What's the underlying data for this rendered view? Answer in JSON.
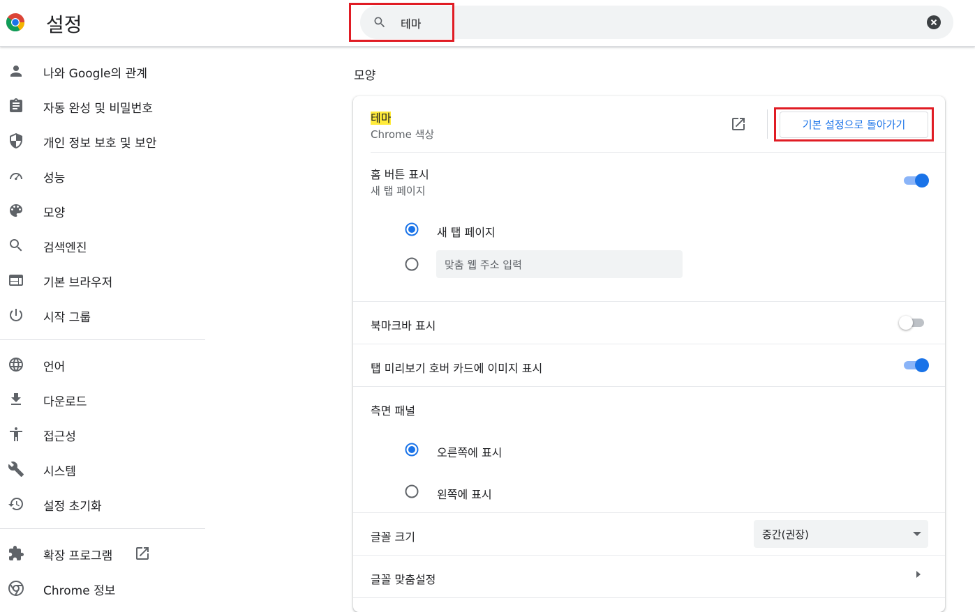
{
  "header": {
    "title": "설정",
    "search_value": "테마"
  },
  "sidebar": {
    "items": [
      {
        "label": "나와 Google의 관계",
        "icon": "person-icon"
      },
      {
        "label": "자동 완성 및 비밀번호",
        "icon": "clipboard-icon"
      },
      {
        "label": "개인 정보 보호 및 보안",
        "icon": "shield-icon"
      },
      {
        "label": "성능",
        "icon": "speedometer-icon"
      },
      {
        "label": "모양",
        "icon": "palette-icon"
      },
      {
        "label": "검색엔진",
        "icon": "search-icon"
      },
      {
        "label": "기본 브라우저",
        "icon": "browser-icon"
      },
      {
        "label": "시작 그룹",
        "icon": "power-icon"
      },
      {
        "label": "언어",
        "icon": "globe-icon"
      },
      {
        "label": "다운로드",
        "icon": "download-icon"
      },
      {
        "label": "접근성",
        "icon": "accessibility-icon"
      },
      {
        "label": "시스템",
        "icon": "wrench-icon"
      },
      {
        "label": "설정 초기화",
        "icon": "history-icon"
      },
      {
        "label": "확장 프로그램",
        "icon": "puzzle-icon"
      },
      {
        "label": "Chrome 정보",
        "icon": "chrome-icon"
      }
    ]
  },
  "main": {
    "section_title": "모양",
    "theme": {
      "title": "테마",
      "subtitle": "Chrome 색상",
      "reset_label": "기본 설정으로 돌아가기"
    },
    "home_button": {
      "title": "홈 버튼 표시",
      "subtitle": "새 탭 페이지",
      "enabled": true,
      "options": [
        "새 탭 페이지",
        ""
      ],
      "selected": 0,
      "url_placeholder": "맞춤 웹 주소 입력"
    },
    "bookmarks_bar": {
      "title": "북마크바 표시",
      "enabled": false
    },
    "tab_hover": {
      "title": "탭 미리보기 호버 카드에 이미지 표시",
      "enabled": true
    },
    "side_panel": {
      "title": "측면 패널",
      "options": [
        "오른쪽에 표시",
        "왼쪽에 표시"
      ],
      "selected": 0
    },
    "font_size": {
      "title": "글꼴 크기",
      "value": "중간(권장)"
    },
    "customize_fonts": {
      "title": "글꼴 맞춤설정"
    }
  },
  "colors": {
    "accent": "#1a73e8",
    "highlight_box": "#e01c24",
    "search_highlight": "#ffeb3b"
  }
}
